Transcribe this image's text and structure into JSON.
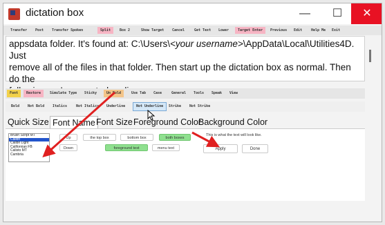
{
  "window": {
    "title": "dictation box",
    "minimize_glyph": "—",
    "maximize_glyph": "☐",
    "close_glyph": "✕"
  },
  "toolbar": {
    "items": [
      {
        "label": "Transfer",
        "highlight": false
      },
      {
        "label": "Post",
        "highlight": false
      },
      {
        "label": "Transfer Spoken",
        "highlight": false
      },
      {
        "label": "Split",
        "highlight": true
      },
      {
        "label": "Box 2",
        "highlight": false
      },
      {
        "label": "Show Target",
        "highlight": false
      },
      {
        "label": "Cancel",
        "highlight": false
      },
      {
        "label": "Get Text",
        "highlight": false
      },
      {
        "label": "Lower",
        "highlight": false
      },
      {
        "label": "Target Enter",
        "highlight": true
      },
      {
        "label": "Previous",
        "highlight": false
      },
      {
        "label": "Edit",
        "highlight": false
      },
      {
        "label": "Help Me",
        "highlight": false
      },
      {
        "label": "Exit",
        "highlight": false
      }
    ]
  },
  "textarea": {
    "line1": "appsdata folder. It's found at: C:\\Users\\",
    "user_placeholder": "<your username>",
    "line1_rest": "\\AppData\\Local\\Utilities4D. Just",
    "line2": "remove all of the files in that folder. Then start up the dictation box as normal. Then do the",
    "line3": "following as I suggested earlier:"
  },
  "format_bar": {
    "items": [
      {
        "label": "Font"
      },
      {
        "label": "Restore"
      },
      {
        "label": "Simulate Type"
      },
      {
        "label": "Sticky"
      },
      {
        "label": "Un Bold"
      },
      {
        "label": "Use Tab"
      },
      {
        "label": "Case"
      },
      {
        "label": "General"
      },
      {
        "label": "Tools"
      },
      {
        "label": "Speak"
      },
      {
        "label": "View"
      }
    ]
  },
  "style_bar": {
    "items": [
      {
        "label": "Bold"
      },
      {
        "label": "Not Bold"
      },
      {
        "label": "Italics"
      },
      {
        "label": "Not Italics"
      },
      {
        "label": "Underline"
      },
      {
        "label": "Not Underline"
      },
      {
        "label": "Strike"
      },
      {
        "label": "Not Strike"
      }
    ]
  },
  "tabs": [
    {
      "label": "Quick Size"
    },
    {
      "label": "Font Name"
    },
    {
      "label": "Font Size"
    },
    {
      "label": "Foreground Color"
    },
    {
      "label": "Background Color"
    }
  ],
  "font_panel": {
    "fonts": [
      "Brush Script MT",
      "Calibri",
      "Calibri Light",
      "Californian FB",
      "Calisto MT",
      "Cambria"
    ],
    "selected_index": 1,
    "up_label": "Up",
    "down_label": "Down",
    "top_box_label": "the top box",
    "bottom_box_label": "bottom box",
    "both_boxes_label": "both boxes",
    "foreground_text_label": "foreground text",
    "menu_text_label": "menu text",
    "preview_text": "This is what the text will look like.",
    "apply_label": "Apply",
    "done_label": "Done"
  },
  "colors": {
    "close_button": "#e81123",
    "toolbar_pink": "#f7b5c4",
    "font_yellow": "#f2d14a",
    "selected_green": "#8fe08f",
    "annotation_arrow": "#e02020"
  }
}
